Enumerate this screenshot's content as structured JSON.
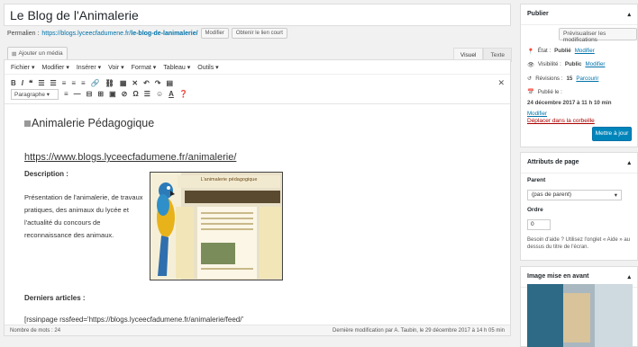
{
  "title": "Le Blog de l'Animalerie",
  "permalink": {
    "label": "Permalien :",
    "url_base": "https://blogs.lyceecfadumene.fr/",
    "url_slug": "le-blog-de-lanimalerie/",
    "modify_label": "Modifier",
    "shortlink_label": "Obtenir le lien court"
  },
  "editor": {
    "add_media_label": "Ajouter un média",
    "tab_visual": "Visuel",
    "tab_text": "Texte",
    "menu": [
      "Fichier",
      "Modifier",
      "Insérer",
      "Voir",
      "Format",
      "Tableau",
      "Outils"
    ],
    "toolbar1": [
      "B",
      "I",
      "❝",
      "☰",
      "☰",
      "≡",
      "≡",
      "≡",
      "🔗",
      "⛓",
      "▦",
      "✕",
      "↶",
      "↷",
      "▤"
    ],
    "format_select": "Paragraphe",
    "toolbar2": [
      "≡",
      "—",
      "⊟",
      "⊞",
      "▣",
      "⊘",
      "Ω",
      "☰",
      "☺",
      "A",
      "❓"
    ],
    "fullscreen_icon": "✕"
  },
  "content": {
    "heading": "Animalerie Pédagogique",
    "url": "https://www.blogs.lyceecfadumene.fr/animalerie/",
    "description_title": "Description :",
    "description_text": "Présentation de l'animalerie, de travaux pratiques, des animaux du lycée et l'actualité du concours de reconnaissance des animaux.",
    "thumb_header": "L'animalerie pédagogique",
    "latest_title": "Derniers articles :",
    "shortcode": "[rssinpage rssfeed='https://blogs.lyceecfadumene.fr/animalerie/feed/'"
  },
  "statusbar": {
    "word_count": "Nombre de mots : 24",
    "last_modified": "Dernière modification par A. Taubin, le 29 décembre 2017 à 14 h 05 min"
  },
  "publish": {
    "title": "Publier",
    "preview": "Prévisualiser les modifications",
    "status_label": "État :",
    "status_value": "Publié",
    "visibility_label": "Visibilité :",
    "visibility_value": "Public",
    "revisions_label": "Révisions :",
    "revisions_value": "15",
    "revisions_link": "Parcourir",
    "published_label": "Publié le :",
    "published_value": "24 décembre 2017 à 11 h 10 min",
    "modify": "Modifier",
    "trash": "Déplacer dans la corbeille",
    "update": "Mettre à jour"
  },
  "attributes": {
    "title": "Attributs de page",
    "parent_label": "Parent",
    "parent_value": "(pas de parent)",
    "order_label": "Ordre",
    "order_value": "0",
    "help": "Besoin d'aide ? Utilisez l'onglet « Aide » au dessus du titre de l'écran."
  },
  "featured": {
    "title": "Image mise en avant"
  }
}
